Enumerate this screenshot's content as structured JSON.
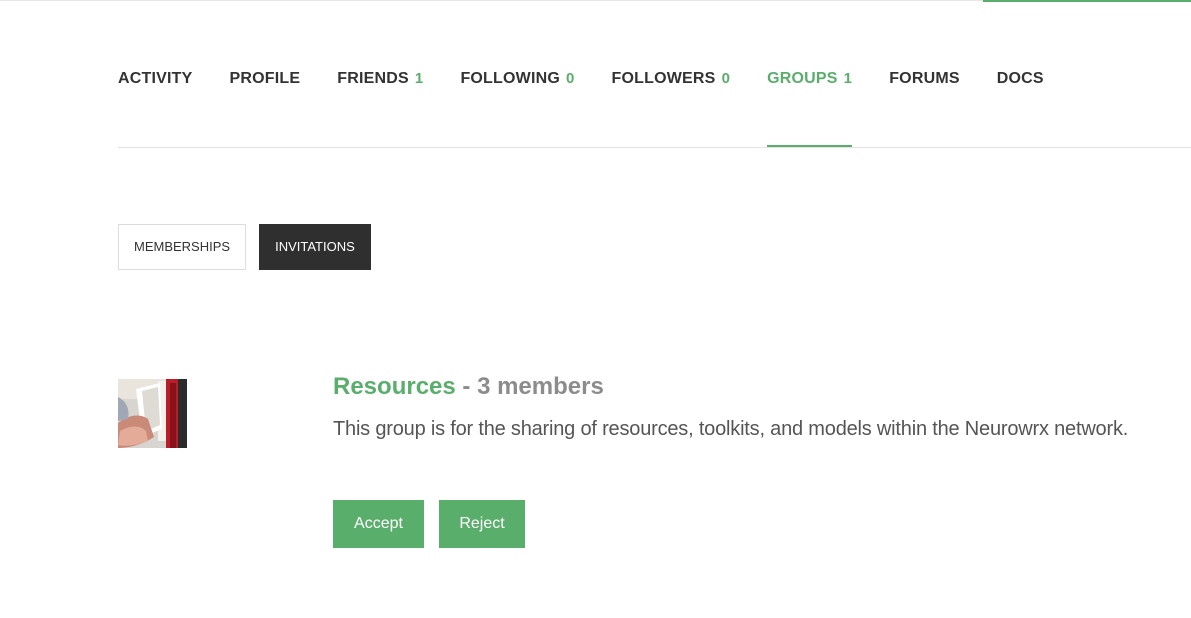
{
  "nav": {
    "items": [
      {
        "label": "ACTIVITY",
        "count": null,
        "active": false
      },
      {
        "label": "PROFILE",
        "count": null,
        "active": false
      },
      {
        "label": "FRIENDS",
        "count": "1",
        "active": false
      },
      {
        "label": "FOLLOWING",
        "count": "0",
        "active": false
      },
      {
        "label": "FOLLOWERS",
        "count": "0",
        "active": false
      },
      {
        "label": "GROUPS",
        "count": "1",
        "active": true
      },
      {
        "label": "FORUMS",
        "count": null,
        "active": false
      },
      {
        "label": "DOCS",
        "count": null,
        "active": false
      }
    ]
  },
  "subtabs": [
    {
      "label": "MEMBERSHIPS",
      "active": false
    },
    {
      "label": "INVITATIONS",
      "active": true
    }
  ],
  "group": {
    "name": "Resources",
    "separator": " - ",
    "members": "3 members",
    "description": "This group is for the sharing of resources, toolkits, and models within the Neurowrx network.",
    "accept_label": "Accept",
    "reject_label": "Reject"
  },
  "colors": {
    "accent": "#5aae6c",
    "dark": "#2f2f2f",
    "text": "#333333"
  }
}
